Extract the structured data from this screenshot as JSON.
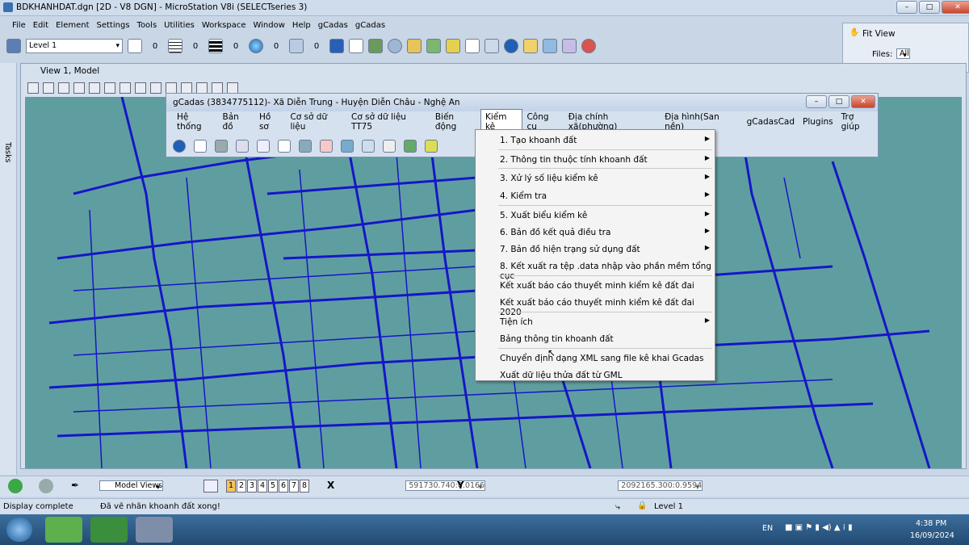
{
  "window": {
    "title": "BDKHANHDAT.dgn [2D - V8 DGN] - MicroStation V8i (SELECTseries 3)"
  },
  "menu": [
    "File",
    "Edit",
    "Element",
    "Settings",
    "Tools",
    "Utilities",
    "Workspace",
    "Window",
    "Help",
    "gCadas",
    "gCadas"
  ],
  "toolbar": {
    "level": "Level 1",
    "zero1": "0",
    "zero2": "0",
    "zero3": "0",
    "zero4": "0",
    "zero5": "0"
  },
  "fitview": {
    "title": "Fit View",
    "files_label": "Files:",
    "files_value": "All"
  },
  "tasks": "Tasks",
  "view": {
    "title": "View 1, Model"
  },
  "gcadas": {
    "title": "gCadas (3834775112)- Xã Diễn Trung - Huyện Diễn Châu - Nghệ An",
    "menu": [
      "Hệ thống",
      "Bản đồ",
      "Hồ sơ",
      "Cơ sở dữ liệu",
      "Cơ sở dữ liệu TT75",
      "Biến động",
      "Kiểm kê",
      "Công cụ",
      "Địa chính xã(phường)",
      "Địa hình(San nền)",
      "gCadasCad",
      "Plugins",
      "Trợ giúp"
    ]
  },
  "dropdown": [
    {
      "label": "1. Tạo khoanh đất",
      "arrow": true
    },
    {
      "label": "2. Thông tin thuộc tính khoanh đất",
      "arrow": true
    },
    {
      "label": "3. Xử lý số liệu kiểm kê",
      "arrow": true
    },
    {
      "label": "4. Kiểm tra",
      "arrow": true
    },
    {
      "label": "5. Xuất biểu kiểm kê",
      "arrow": true
    },
    {
      "label": "6. Bản đồ kết quả điều tra",
      "arrow": true
    },
    {
      "label": "7. Bản đồ hiện trạng sử dụng đất",
      "arrow": true
    },
    {
      "label": "8. Kết xuất ra tệp .data nhập vào phần mềm tổng cục",
      "arrow": false
    },
    {
      "label": "Kết xuất báo cáo thuyết minh kiểm kê đất đai",
      "arrow": false
    },
    {
      "label": "Kết xuất báo cáo thuyết minh kiểm kê đất đai 2020",
      "arrow": false
    },
    {
      "label": "Tiện ích",
      "arrow": true
    },
    {
      "label": "Bảng thông tin khoanh đất",
      "arrow": false
    },
    {
      "label": "Chuyển định dạng XML sang file kê khai Gcadas",
      "arrow": false
    },
    {
      "label": "Xuất dữ liệu thửa đất từ GML",
      "arrow": false
    }
  ],
  "bottom": {
    "model_views": "Model Views",
    "views": [
      "1",
      "2",
      "3",
      "4",
      "5",
      "6",
      "7",
      "8"
    ],
    "x_label": "X",
    "x_value": "591730.740:0.0166",
    "y_label": "Y",
    "y_value": "2092165.300:0.9594"
  },
  "status": {
    "left": "Display complete",
    "message": "Đã vẽ nhãn khoanh đất xong!",
    "level": "Level 1"
  },
  "taskbar": {
    "lang": "EN",
    "time": "4:38 PM",
    "date": "16/09/2024"
  },
  "colors": {
    "canvas": "#5f9ea0",
    "lines": "#1616c8"
  }
}
